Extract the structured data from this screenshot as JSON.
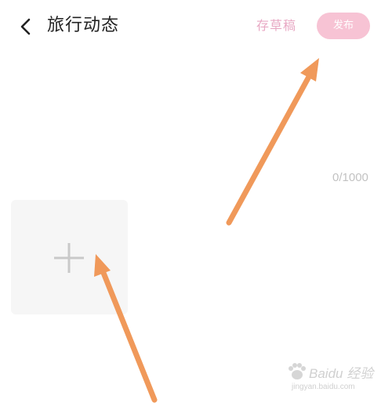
{
  "header": {
    "back_icon": "chevron-left-icon",
    "title": "旅行动态",
    "draft_label": "存草稿",
    "publish_label": "发布"
  },
  "editor": {
    "char_count": "0/1000"
  },
  "photos": {
    "add_icon": "plus-icon"
  },
  "watermark": {
    "brand": "Baidu 经验",
    "url": "jingyan.baidu.com"
  },
  "colors": {
    "draft_text": "#e8a9c4",
    "publish_bg": "#f7c3d4",
    "arrow": "#f0995a",
    "add_tile_bg": "#f6f6f6",
    "plus": "#c9c9c9"
  }
}
